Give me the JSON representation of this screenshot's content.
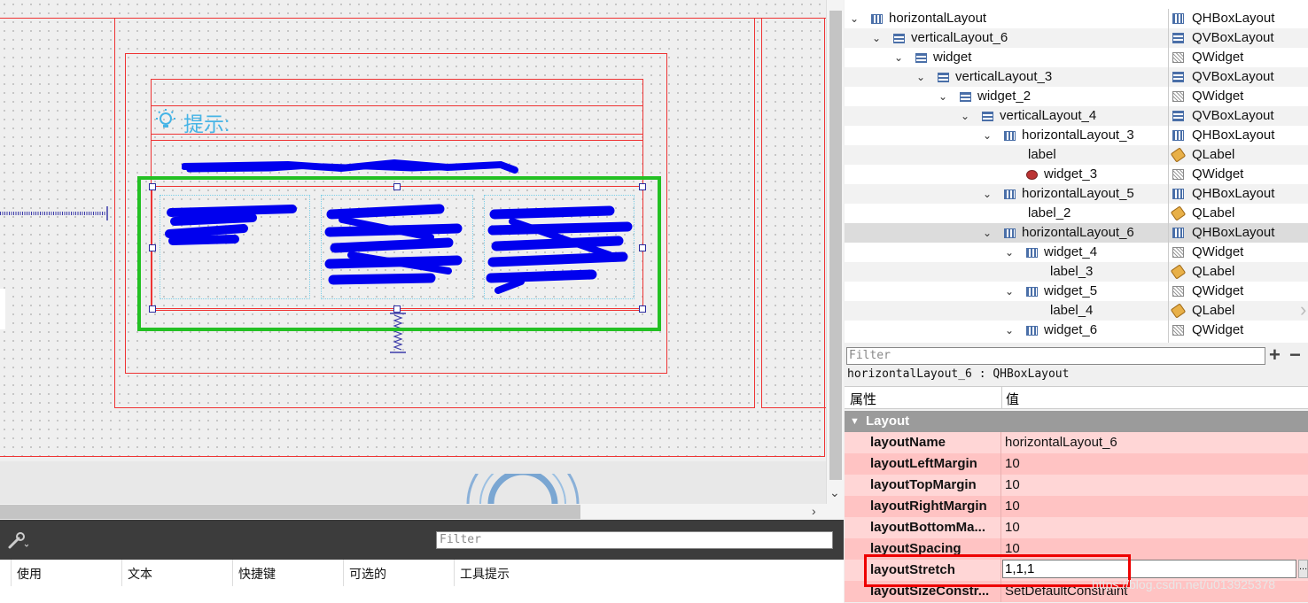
{
  "canvas": {
    "hint_label": "提示:"
  },
  "object_tree": {
    "rows": [
      {
        "name": "horizontalLayout",
        "cls": "QHBoxLayout",
        "expanded": true,
        "icon": "hbox-layout-icon",
        "cls_icon": "hbox-layout-icon"
      },
      {
        "name": "verticalLayout_6",
        "cls": "QVBoxLayout",
        "expanded": true,
        "icon": "vbox-layout-icon",
        "cls_icon": "vbox-layout-icon"
      },
      {
        "name": "widget",
        "cls": "QWidget",
        "expanded": true,
        "icon": "vbox-layout-icon",
        "cls_icon": "widget-icon"
      },
      {
        "name": "verticalLayout_3",
        "cls": "QVBoxLayout",
        "expanded": true,
        "icon": "vbox-layout-icon",
        "cls_icon": "vbox-layout-icon"
      },
      {
        "name": "widget_2",
        "cls": "QWidget",
        "expanded": true,
        "icon": "vbox-layout-icon",
        "cls_icon": "widget-icon"
      },
      {
        "name": "verticalLayout_4",
        "cls": "QVBoxLayout",
        "expanded": true,
        "icon": "vbox-layout-icon",
        "cls_icon": "vbox-layout-icon"
      },
      {
        "name": "horizontalLayout_3",
        "cls": "QHBoxLayout",
        "expanded": true,
        "icon": "hbox-layout-icon",
        "cls_icon": "hbox-layout-icon"
      },
      {
        "name": "label",
        "cls": "QLabel",
        "expanded": null,
        "icon": "",
        "cls_icon": "label-icon"
      },
      {
        "name": "widget_3",
        "cls": "QWidget",
        "expanded": null,
        "icon": "widget-noLayout-icon",
        "cls_icon": "widget-icon"
      },
      {
        "name": "horizontalLayout_5",
        "cls": "QHBoxLayout",
        "expanded": true,
        "icon": "hbox-layout-icon",
        "cls_icon": "hbox-layout-icon"
      },
      {
        "name": "label_2",
        "cls": "QLabel",
        "expanded": null,
        "icon": "",
        "cls_icon": "label-icon"
      },
      {
        "name": "horizontalLayout_6",
        "cls": "QHBoxLayout",
        "expanded": true,
        "icon": "hbox-layout-icon",
        "cls_icon": "hbox-layout-icon",
        "selected": true
      },
      {
        "name": "widget_4",
        "cls": "QWidget",
        "expanded": true,
        "icon": "hbox-layout-icon",
        "cls_icon": "widget-icon"
      },
      {
        "name": "label_3",
        "cls": "QLabel",
        "expanded": null,
        "icon": "",
        "cls_icon": "label-icon"
      },
      {
        "name": "widget_5",
        "cls": "QWidget",
        "expanded": true,
        "icon": "hbox-layout-icon",
        "cls_icon": "widget-icon"
      },
      {
        "name": "label_4",
        "cls": "QLabel",
        "expanded": null,
        "icon": "",
        "cls_icon": "label-icon"
      },
      {
        "name": "widget_6",
        "cls": "QWidget",
        "expanded": true,
        "icon": "hbox-layout-icon",
        "cls_icon": "widget-icon"
      }
    ]
  },
  "property_editor": {
    "filter_placeholder": "Filter",
    "object_line": "horizontalLayout_6 : QHBoxLayout",
    "col_property": "属性",
    "col_value": "值",
    "group": "Layout",
    "rows": [
      {
        "name": "layoutName",
        "value": "horizontalLayout_6"
      },
      {
        "name": "layoutLeftMargin",
        "value": "10"
      },
      {
        "name": "layoutTopMargin",
        "value": "10"
      },
      {
        "name": "layoutRightMargin",
        "value": "10"
      },
      {
        "name": "layoutBottomMa...",
        "value": "10"
      },
      {
        "name": "layoutSpacing",
        "value": "10"
      },
      {
        "name": "layoutStretch",
        "value": ""
      },
      {
        "name": "layoutSizeConstr...",
        "value": "SetDefaultConstraint"
      }
    ],
    "stretch_value": "1,1,1",
    "dots": "..."
  },
  "action_editor": {
    "filter_placeholder": "Filter",
    "columns": [
      "使用",
      "文本",
      "快捷键",
      "可选的",
      "工具提示"
    ]
  },
  "watermark": "https://blog.csdn.net/u013925378"
}
